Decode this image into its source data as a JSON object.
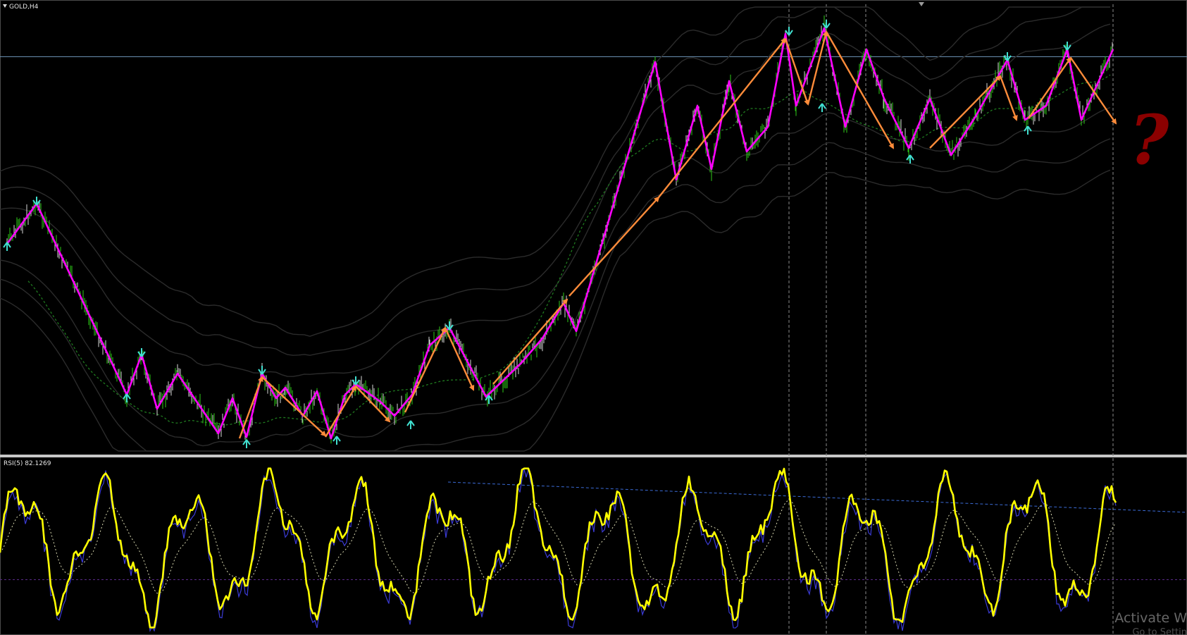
{
  "chart_title": "GOLD,H4",
  "indicator_label": "RSI(5) 82.1269",
  "question_mark": "?",
  "watermark": {
    "line1": "Activate W",
    "line2": "Go to Settin"
  },
  "colors": {
    "background": "#000000",
    "candles_up": "#2ecc17",
    "candles_down": "#e8e8e8",
    "zigzag": "#ff00ff",
    "arrows": "#ff8c3a",
    "fractal_markers": "#40e0d0",
    "bands": "#2a2a2a",
    "dotted_ma": "#1f7a1f",
    "rsi_main": "#ffff00",
    "rsi_secondary": "#3b3bd6",
    "horizontal_level": "#6a8fb0",
    "question_mark": "#8b0000"
  }
}
